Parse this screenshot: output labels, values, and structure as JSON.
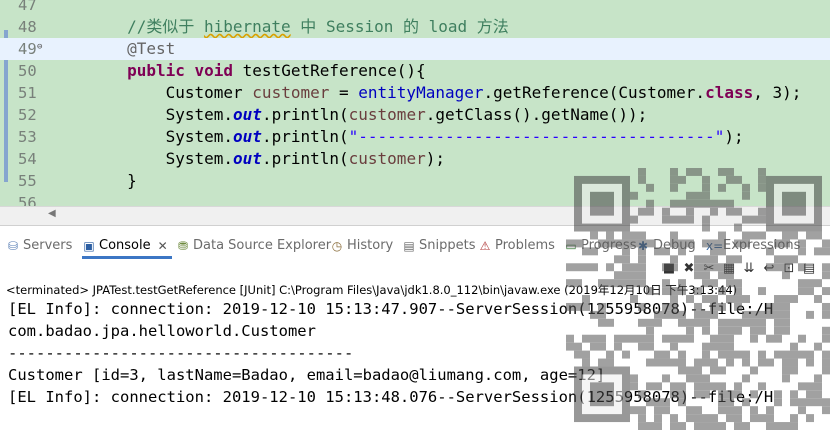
{
  "editor": {
    "lines": [
      {
        "num": "47",
        "segments": []
      },
      {
        "num": "48",
        "segments": [
          {
            "cls": "cm",
            "text": "        //类似于 "
          },
          {
            "cls": "cm squig",
            "text": "hibernate"
          },
          {
            "cls": "cm",
            "text": " 中 Session 的 load 方法"
          }
        ]
      },
      {
        "num": "49",
        "fold": "⊖",
        "current": true,
        "segments": [
          {
            "cls": "ann",
            "text": "        @Test"
          }
        ]
      },
      {
        "num": "50",
        "segments": [
          {
            "cls": "kw",
            "text": "        public void "
          },
          {
            "cls": "",
            "text": "testGetReference(){"
          }
        ]
      },
      {
        "num": "51",
        "segments": [
          {
            "cls": "",
            "text": "            Customer "
          },
          {
            "cls": "var",
            "text": "customer"
          },
          {
            "cls": "",
            "text": " = "
          },
          {
            "cls": "fld",
            "text": "entityManager"
          },
          {
            "cls": "",
            "text": ".getReference(Customer."
          },
          {
            "cls": "kw",
            "text": "class"
          },
          {
            "cls": "",
            "text": ", 3);"
          }
        ]
      },
      {
        "num": "52",
        "segments": [
          {
            "cls": "",
            "text": "            System."
          },
          {
            "cls": "sfld",
            "text": "out"
          },
          {
            "cls": "",
            "text": ".println("
          },
          {
            "cls": "var",
            "text": "customer"
          },
          {
            "cls": "",
            "text": ".getClass().getName());"
          }
        ]
      },
      {
        "num": "53",
        "segments": [
          {
            "cls": "",
            "text": "            System."
          },
          {
            "cls": "sfld",
            "text": "out"
          },
          {
            "cls": "",
            "text": ".println("
          },
          {
            "cls": "str",
            "text": "\"-------------------------------------\""
          },
          {
            "cls": "",
            "text": ");"
          }
        ]
      },
      {
        "num": "54",
        "segments": [
          {
            "cls": "",
            "text": "            System."
          },
          {
            "cls": "sfld",
            "text": "out"
          },
          {
            "cls": "",
            "text": ".println("
          },
          {
            "cls": "var",
            "text": "customer"
          },
          {
            "cls": "",
            "text": ");"
          }
        ]
      },
      {
        "num": "55",
        "segments": [
          {
            "cls": "",
            "text": "        }"
          }
        ]
      },
      {
        "num": "56",
        "segments": []
      }
    ]
  },
  "tabs": [
    {
      "name": "tab-servers",
      "label": "Servers",
      "icon": "servers-icon",
      "glyph": "⛁",
      "color": "#5a7fb5"
    },
    {
      "name": "tab-console",
      "label": "Console",
      "icon": "console-icon",
      "glyph": "▣",
      "color": "#2d5fa3",
      "active": true
    },
    {
      "name": "tab-data-source-explorer",
      "label": "Data Source Explorer",
      "icon": "database-icon",
      "glyph": "⛃",
      "color": "#6e8a3e"
    },
    {
      "name": "tab-history",
      "label": "History",
      "icon": "history-icon",
      "glyph": "◷",
      "color": "#8a6d3b"
    },
    {
      "name": "tab-snippets",
      "label": "Snippets",
      "icon": "snippets-icon",
      "glyph": "▤",
      "color": "#6b6b6b"
    },
    {
      "name": "tab-problems",
      "label": "Problems",
      "icon": "problems-icon",
      "glyph": "⚠",
      "color": "#b03a3a"
    },
    {
      "name": "tab-progress",
      "label": "Progress",
      "icon": "progress-icon",
      "glyph": "▭",
      "color": "#3a7a3a"
    },
    {
      "name": "tab-debug",
      "label": "Debug",
      "icon": "debug-icon",
      "glyph": "✱",
      "color": "#3a6aa3"
    },
    {
      "name": "tab-expressions",
      "label": "Expressions",
      "icon": "expressions-icon",
      "glyph": "x=",
      "color": "#3a6aa3"
    }
  ],
  "toolbar": [
    {
      "name": "remove-launch-button",
      "icon": "square-icon",
      "glyph": "■"
    },
    {
      "name": "remove-all-terminated-button",
      "icon": "remove-all-icon",
      "glyph": "✖"
    },
    {
      "name": "remove-terminated-button",
      "icon": "remove-terminated-icon",
      "glyph": "✂"
    },
    {
      "name": "clear-console-button",
      "icon": "clear-console-icon",
      "glyph": "▦"
    },
    {
      "name": "scroll-lock-button",
      "icon": "scroll-lock-icon",
      "glyph": "⇊"
    },
    {
      "name": "word-wrap-button",
      "icon": "word-wrap-icon",
      "glyph": "↩"
    },
    {
      "name": "pin-console-button",
      "icon": "pin-icon",
      "glyph": "⊡"
    },
    {
      "name": "open-console-button",
      "icon": "open-console-icon",
      "glyph": "▤"
    }
  ],
  "console": {
    "terminated": "<terminated> JPATest.testGetReference [JUnit] C:\\Program Files\\Java\\jdk1.8.0_112\\bin\\javaw.exe (2019年12月10日 下午3:13:44)",
    "lines": [
      "[EL Info]: connection: 2019-12-10 15:13:47.907--ServerSession(1255958078)--file:/H",
      "com.badao.jpa.helloworld.Customer",
      "-------------------------------------",
      "Customer [id=3, lastName=Badao, email=badao@liumang.com, age=12]",
      "[EL Info]: connection: 2019-12-10 15:13:48.076--ServerSession(1255958078)--file:/H"
    ]
  }
}
